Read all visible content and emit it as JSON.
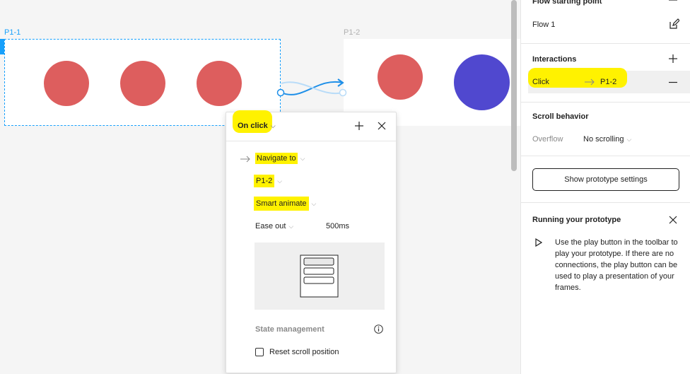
{
  "canvas": {
    "frame1_label": "P1-1",
    "frame2_label": "P1-2",
    "colors": {
      "red": "#dd5e5e",
      "blue": "#5048cf",
      "selection": "#18a0fb",
      "connector": "#1e8fe8"
    }
  },
  "panel": {
    "flow_header": "Flow starting point",
    "flow_name": "Flow 1",
    "interactions_header": "Interactions",
    "interaction_trigger": "Click",
    "interaction_target": "P1-2",
    "scroll_header": "Scroll behavior",
    "overflow_label": "Overflow",
    "overflow_value": "No scrolling",
    "show_settings_button": "Show prototype settings",
    "running_header": "Running your prototype",
    "running_text": "Use the play button in the toolbar to play your prototype. If there are no connections, the play button can be used to play a presentation of your frames."
  },
  "popup": {
    "trigger": "On click",
    "action": "Navigate to",
    "destination": "P1-2",
    "animation": "Smart animate",
    "easing": "Ease out",
    "duration": "500ms",
    "state_header": "State management",
    "reset_scroll_label": "Reset scroll position"
  }
}
